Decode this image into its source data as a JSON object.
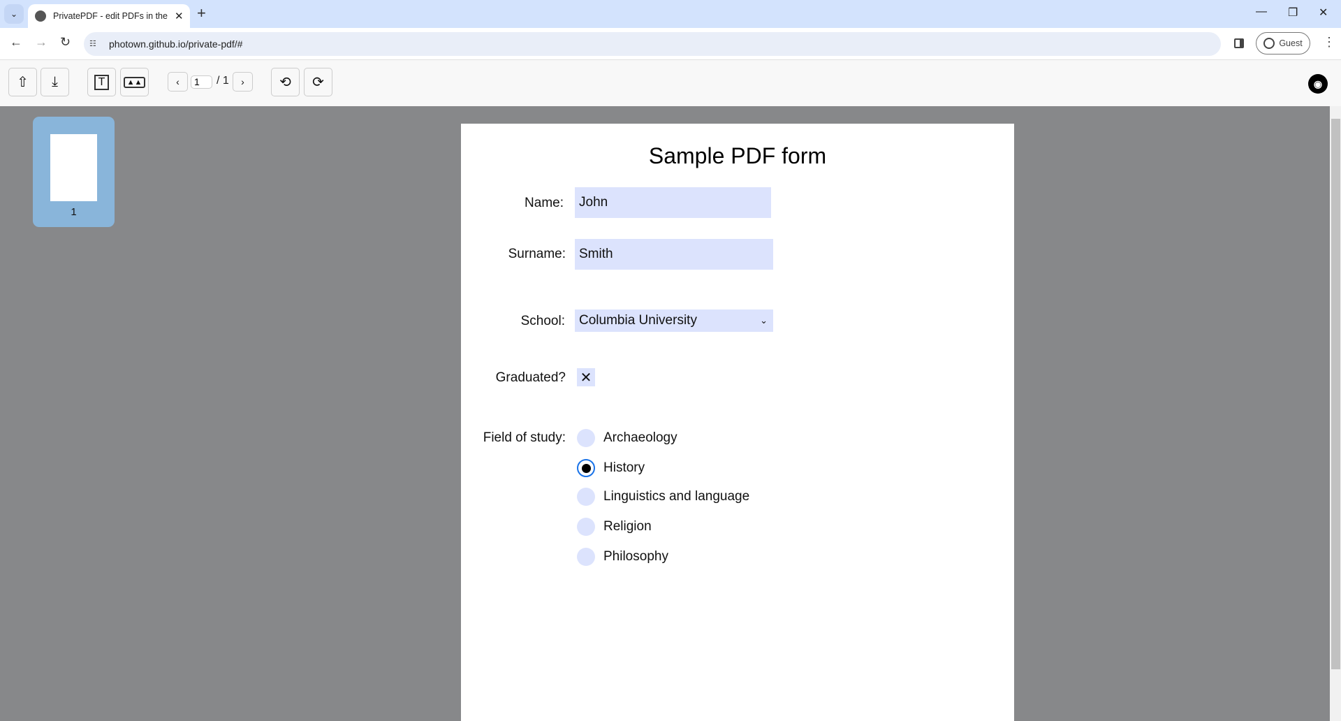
{
  "browser": {
    "tab_title": "PrivatePDF - edit PDFs in the browser",
    "url": "photown.github.io/private-pdf/#",
    "profile": "Guest"
  },
  "toolbar": {
    "page_current": "1",
    "page_total": "/ 1"
  },
  "thumbnails": [
    {
      "label": "1"
    }
  ],
  "form": {
    "title": "Sample PDF form",
    "name_label": "Name:",
    "name_value": "John",
    "surname_label": "Surname:",
    "surname_value": "Smith",
    "school_label": "School:",
    "school_value": "Columbia University",
    "graduated_label": "Graduated?",
    "graduated_checked": true,
    "field_label": "Field of study:",
    "fields": [
      "Archaeology",
      "History",
      "Linguistics and language",
      "Religion",
      "Philosophy"
    ],
    "field_selected": "History",
    "field_color": "#dce3fd"
  }
}
